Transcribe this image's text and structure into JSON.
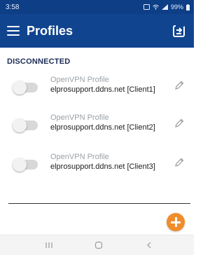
{
  "status": {
    "time": "3:58",
    "battery": "99%"
  },
  "appbar": {
    "title": "Profiles",
    "background": "#10448f"
  },
  "section": {
    "title": "DISCONNECTED"
  },
  "profiles": [
    {
      "name": "OpenVPN Profile",
      "server": "elprosupport.ddns.net [Client1]",
      "connected": false
    },
    {
      "name": "OpenVPN Profile",
      "server": "elprosupport.ddns.net [Client2]",
      "connected": false
    },
    {
      "name": "OpenVPN Profile",
      "server": "elprosupport.ddns.net [Client3]",
      "connected": false
    }
  ],
  "icons": {
    "menu": "menu-icon",
    "import": "import-profile-icon",
    "edit": "pencil-icon",
    "add": "plus-icon",
    "recent": "recent-apps-icon",
    "home": "home-icon",
    "back": "back-icon"
  },
  "colors": {
    "accent": "#f08c2a",
    "statusbar": "#0d3e86"
  }
}
